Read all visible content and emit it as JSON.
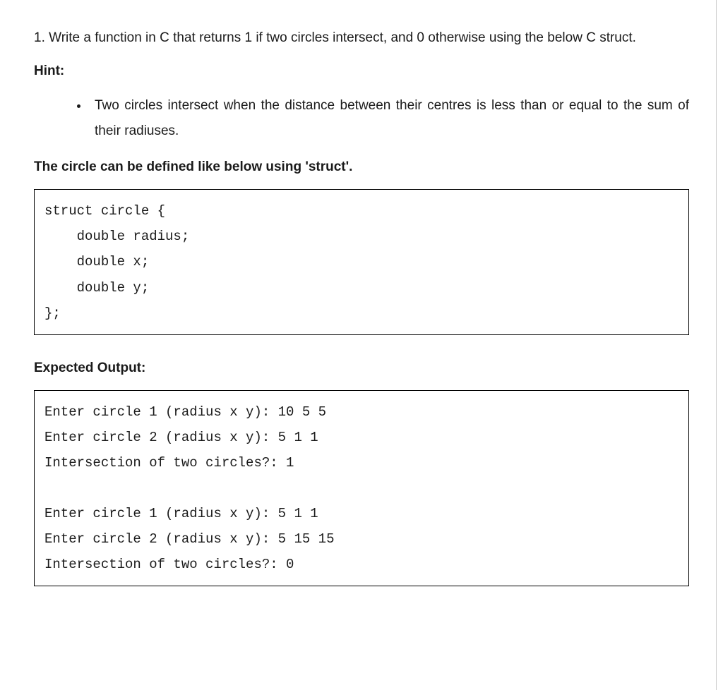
{
  "question": "1. Write a function in C that returns 1 if two circles intersect, and 0 otherwise using the below C struct.",
  "hint_heading": "Hint:",
  "hint_item": "Two circles intersect when the distance between their centres is less than or equal to the sum of their radiuses.",
  "struct_heading": "The circle can be defined like below using 'struct'.",
  "struct_code": "struct circle {\n    double radius;\n    double x;\n    double y;\n};",
  "output_heading": "Expected Output:",
  "output_text": "Enter circle 1 (radius x y): 10 5 5\nEnter circle 2 (radius x y): 5 1 1\nIntersection of two circles?: 1\n\nEnter circle 1 (radius x y): 5 1 1\nEnter circle 2 (radius x y): 5 15 15\nIntersection of two circles?: 0"
}
